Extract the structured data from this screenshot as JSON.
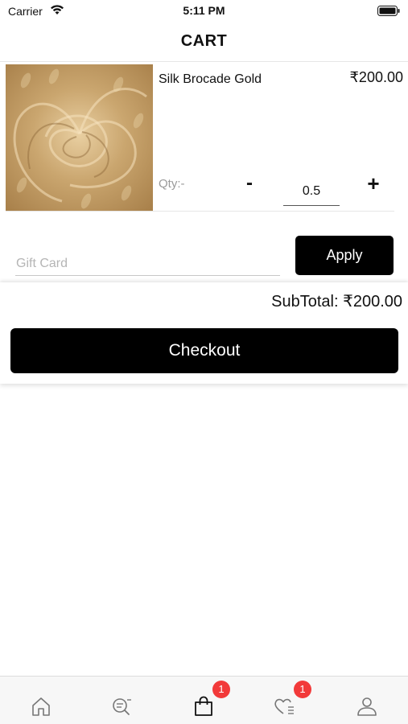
{
  "status_bar": {
    "carrier": "Carrier",
    "time": "5:11 PM"
  },
  "header": {
    "title": "CART"
  },
  "cart": {
    "items": [
      {
        "name": "Silk Brocade Gold",
        "price": "₹200.00",
        "qty_label": "Qty:-",
        "qty_value": "0.5",
        "minus_label": "-",
        "plus_label": "+"
      }
    ]
  },
  "gift_card": {
    "placeholder": "Gift Card",
    "value": "",
    "apply_label": "Apply"
  },
  "summary": {
    "subtotal": "SubTotal: ₹200.00",
    "checkout_label": "Checkout"
  },
  "tab_bar": {
    "tabs": [
      {
        "icon": "home-icon"
      },
      {
        "icon": "search-list-icon"
      },
      {
        "icon": "shopping-bag-icon",
        "badge": "1"
      },
      {
        "icon": "wishlist-heart-icon",
        "badge": "1"
      },
      {
        "icon": "profile-icon"
      }
    ]
  },
  "colors": {
    "primary_button": "#000000",
    "badge": "#f23a3a",
    "tab_bar_bg": "#f7f7f7"
  }
}
